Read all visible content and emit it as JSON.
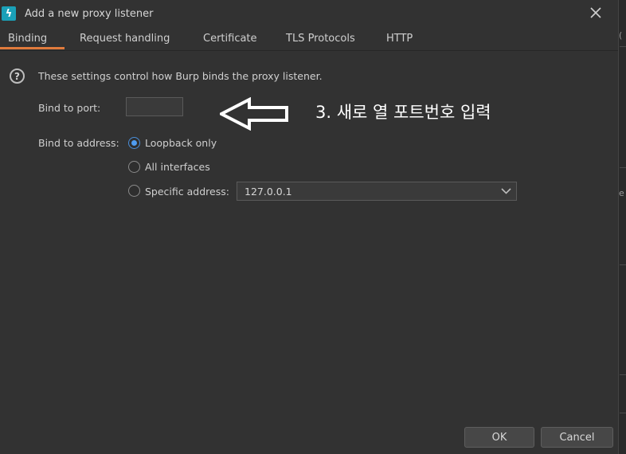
{
  "window": {
    "title": "Add a new proxy listener",
    "icon": "burp-lightning-icon"
  },
  "tabs": [
    {
      "label": "Binding",
      "active": true
    },
    {
      "label": "Request handling"
    },
    {
      "label": "Certificate"
    },
    {
      "label": "TLS Protocols"
    },
    {
      "label": "HTTP"
    }
  ],
  "binding": {
    "info": "These settings control how Burp binds the proxy listener.",
    "port_label": "Bind to port:",
    "port_value": "",
    "address_label": "Bind to address:",
    "options": [
      {
        "label": "Loopback only",
        "selected": true
      },
      {
        "label": "All interfaces",
        "selected": false
      },
      {
        "label": "Specific address:",
        "selected": false
      }
    ],
    "specific_address_value": "127.0.0.1"
  },
  "annotation": {
    "text": "3. 새로 열 포트번호 입력"
  },
  "footer": {
    "ok_label": "OK",
    "cancel_label": "Cancel"
  },
  "colors": {
    "accent": "#e07b3c",
    "radio": "#4f9cf0",
    "background": "#323232"
  }
}
